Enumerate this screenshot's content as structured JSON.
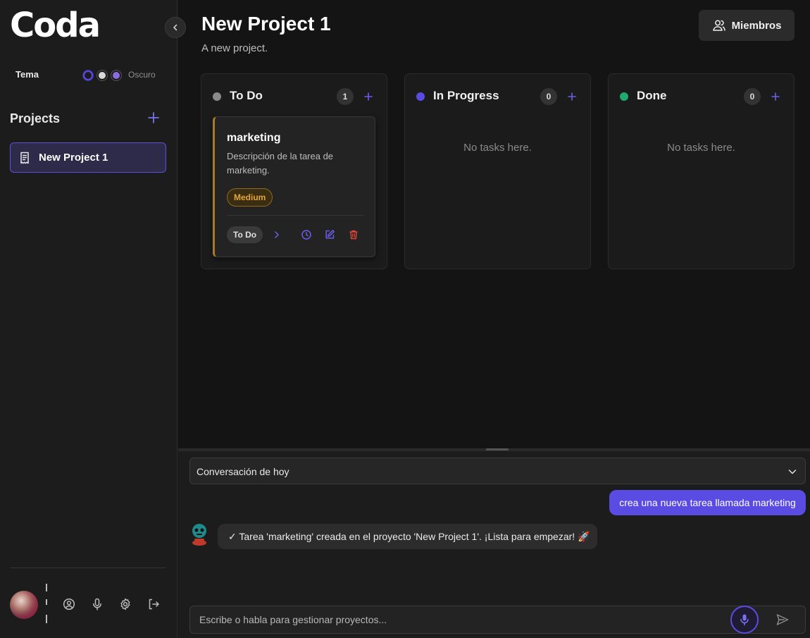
{
  "sidebar": {
    "logo": "Coda",
    "theme_label": "Tema",
    "theme_value": "Oscuro",
    "projects_title": "Projects",
    "projects": [
      {
        "name": "New Project 1",
        "icon": "receipt-icon",
        "active": true
      }
    ]
  },
  "header": {
    "title": "New Project 1",
    "subtitle": "A new project.",
    "members_label": "Miembros"
  },
  "board": {
    "columns": [
      {
        "title": "To Do",
        "count": "1",
        "dot_color": "#8a8a8a",
        "tasks": [
          {
            "title": "marketing",
            "description": "Descripción de la tarea de marketing.",
            "priority": "Medium",
            "status": "To Do"
          }
        ]
      },
      {
        "title": "In Progress",
        "count": "0",
        "dot_color": "#5b4be6",
        "empty_text": "No tasks here."
      },
      {
        "title": "Done",
        "count": "0",
        "dot_color": "#1faa70",
        "empty_text": "No tasks here."
      }
    ]
  },
  "chat": {
    "conversation": "Conversación de hoy",
    "messages": [
      {
        "from": "user",
        "text": "crea una nueva tarea llamada marketing"
      },
      {
        "from": "bot",
        "text": "✓ Tarea 'marketing' creada en el proyecto 'New Project 1'. ¡Lista para empezar! 🚀"
      }
    ],
    "input_placeholder": "Escribe o habla para gestionar proyectos..."
  },
  "colors": {
    "accent": "#5a4be2",
    "priority_medium": "#e3a43a",
    "delete": "#e0453a",
    "background": "#141414"
  }
}
